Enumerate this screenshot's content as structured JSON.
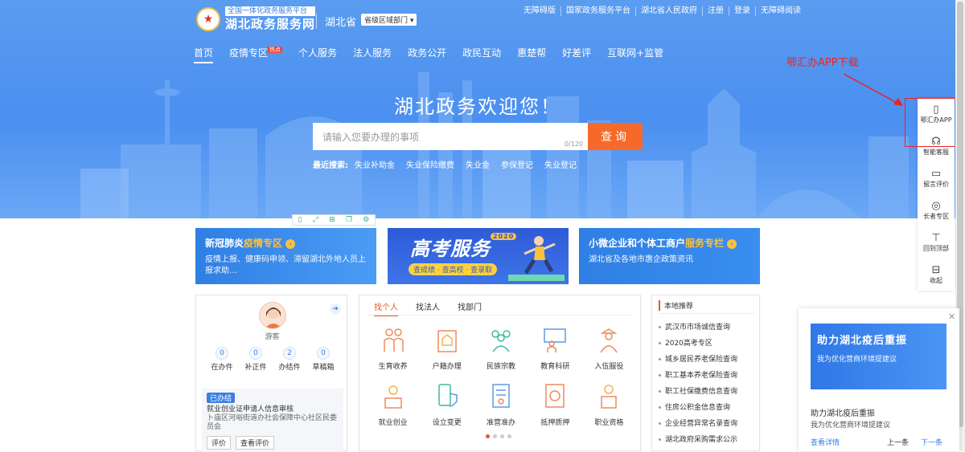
{
  "header": {
    "logo_sub": "全国一体化政务服务平台",
    "logo_main": "湖北政务服务网",
    "region": "湖北省",
    "region_select": "省级区域部门",
    "top_links": [
      "无障碍版",
      "国家政务服务平台",
      "湖北省人民政府",
      "注册",
      "登录",
      "无障碍阅读"
    ]
  },
  "nav": {
    "items": [
      "首页",
      "疫情专区",
      "个人服务",
      "法人服务",
      "政务公开",
      "政民互动",
      "惠楚帮",
      "好差评",
      "互联网+监管"
    ],
    "hot_badge": "热点"
  },
  "hero": {
    "welcome": "湖北政务欢迎您！",
    "search_placeholder": "请输入您要办理的事项",
    "search_count": "0/120",
    "search_button": "查询",
    "hotwords_label": "最近搜索:",
    "hotwords": [
      "失业补助金",
      "失业保险缴费",
      "失业金",
      "参保登记",
      "失业登记"
    ]
  },
  "annotation": {
    "text": "鄂汇办APP下载"
  },
  "sidebar": {
    "items": [
      {
        "label": "鄂汇办APP",
        "icon": "mobile-icon"
      },
      {
        "label": "智能客服",
        "icon": "headset-icon"
      },
      {
        "label": "留言评价",
        "icon": "message-icon"
      },
      {
        "label": "长者专区",
        "icon": "elder-icon"
      },
      {
        "label": "回到顶部",
        "icon": "back-top-icon"
      },
      {
        "label": "收起",
        "icon": "collapse-icon"
      }
    ]
  },
  "banners": {
    "covid_title_1": "新冠肺炎",
    "covid_title_2": "疫情专区",
    "covid_desc": "疫情上报、健康码申领、滞留湖北外地人员上报求助…",
    "exam_title": "高考服务",
    "exam_year": "2020",
    "exam_sub": "查成绩 · 查高校 · 查录取",
    "biz_title_1": "小微企业和个体工商户",
    "biz_title_2": "服务专栏",
    "biz_desc": "湖北省及各地市惠企政策资讯"
  },
  "user": {
    "name": "游客",
    "stats": [
      {
        "num": "0",
        "label": "在办件"
      },
      {
        "num": "0",
        "label": "补正件"
      },
      {
        "num": "2",
        "label": "办结件"
      },
      {
        "num": "0",
        "label": "草稿箱"
      }
    ],
    "progress_tag": "已办结",
    "progress_title": "就业创业证申请人信息审核",
    "progress_dept": "卜庙区河峪街道办社会保障中心社区民委员会",
    "progress_btn_1": "评价",
    "progress_btn_2": "查看评价"
  },
  "services": {
    "tabs": [
      "找个人",
      "找法人",
      "找部门"
    ],
    "items": [
      "生育收养",
      "户籍办理",
      "民族宗教",
      "教育科研",
      "入伍服役",
      "就业创业",
      "设立变更",
      "准营准办",
      "抵押质押",
      "职业资格"
    ]
  },
  "featured": {
    "title": "本地推荐",
    "items": [
      "武汉市市场诚信查询",
      "2020高考专区",
      "城乡居民养老保险查询",
      "职工基本养老保险查询",
      "职工社保缴费信息查询",
      "住房公积金信息查询",
      "企业经营异常名录查询",
      "湖北政府采购需求公示"
    ]
  },
  "popup": {
    "img_title": "助力湖北疫后重振",
    "img_sub": "我为优化营商环境提建议",
    "title": "助力湖北疫后重振",
    "sub": "我为优化营商环境提建议",
    "link": "查看详情",
    "prev": "上一条",
    "next": "下一条"
  }
}
